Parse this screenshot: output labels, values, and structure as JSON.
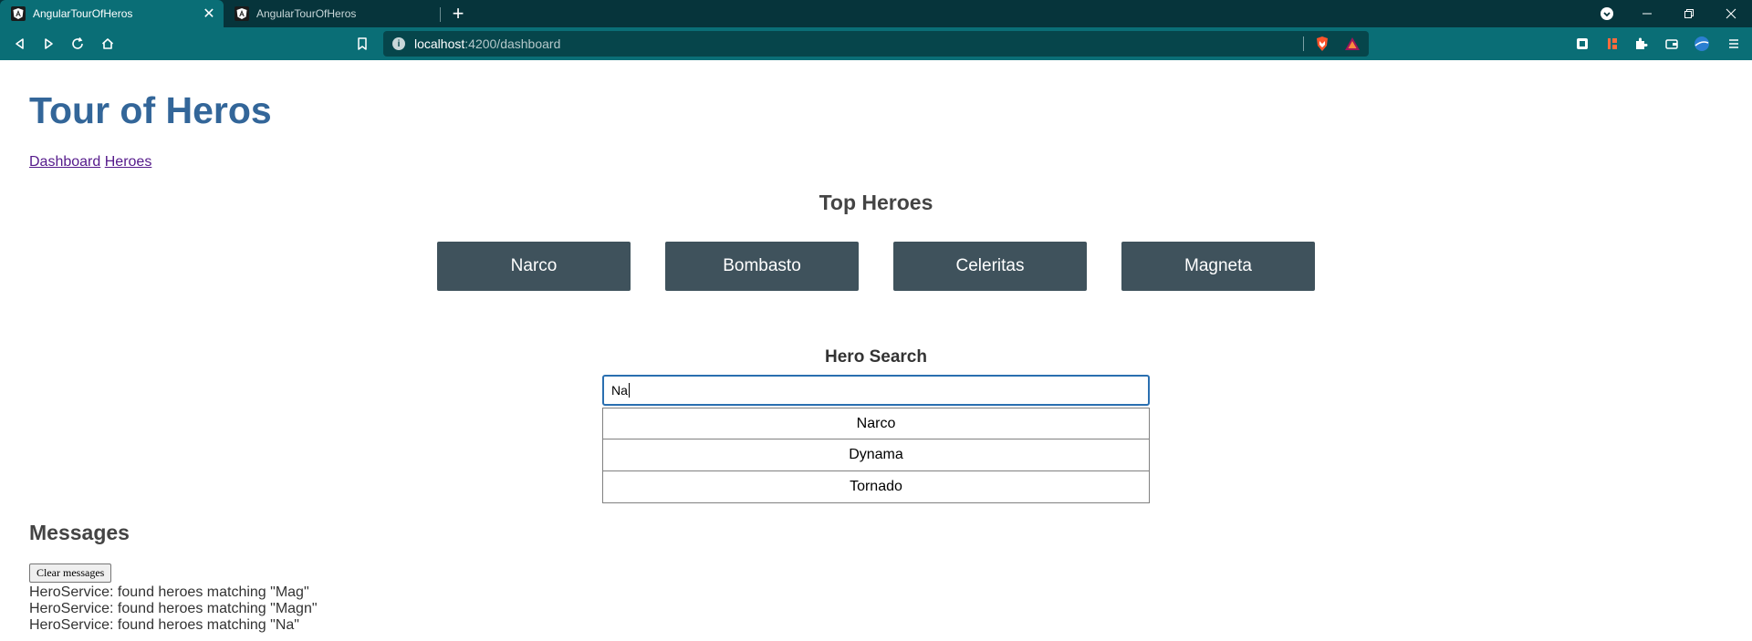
{
  "browser": {
    "tabs": [
      {
        "title": "AngularTourOfHeros",
        "active": true
      },
      {
        "title": "AngularTourOfHeros",
        "active": false
      }
    ],
    "url_host": "localhost",
    "url_path": ":4200/dashboard",
    "icons": {
      "back": "triangle-left-icon",
      "forward": "triangle-right-icon",
      "reload": "reload-icon",
      "home": "home-icon",
      "bookmark": "bookmark-icon",
      "info": "info-icon"
    },
    "colors": {
      "tabbar": "#06343b",
      "toolbar": "#0a6e76"
    }
  },
  "app": {
    "title": "Tour of Heros",
    "nav": {
      "dashboard": "Dashboard",
      "heroes": "Heroes"
    }
  },
  "dashboard": {
    "heading": "Top Heroes",
    "heroes": [
      "Narco",
      "Bombasto",
      "Celeritas",
      "Magneta"
    ]
  },
  "search": {
    "label": "Hero Search",
    "value": "Na",
    "results": [
      "Narco",
      "Dynama",
      "Tornado"
    ]
  },
  "messages": {
    "heading": "Messages",
    "clear_label": "Clear messages",
    "items": [
      "HeroService: found heroes matching \"Mag\"",
      "HeroService: found heroes matching \"Magn\"",
      "HeroService: found heroes matching \"Na\""
    ]
  },
  "colors": {
    "title": "#336699",
    "tile": "#3f525c",
    "link_visited": "#551a8b"
  }
}
